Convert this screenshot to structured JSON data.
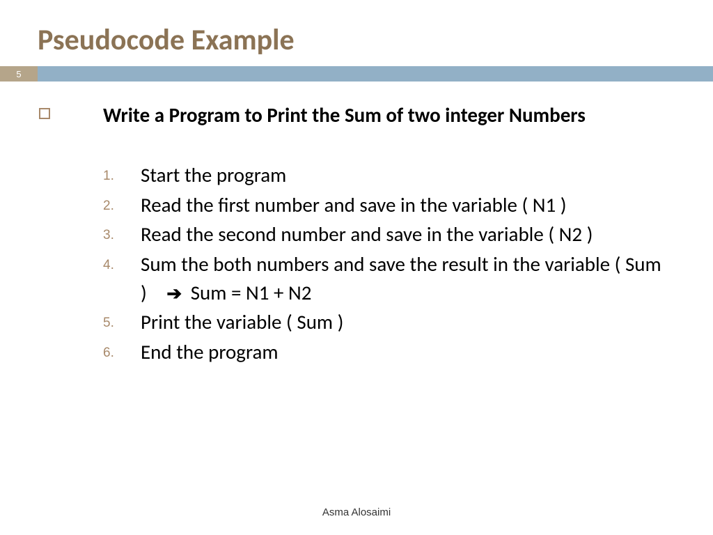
{
  "title": "Pseudocode Example",
  "page_number": "5",
  "headline": "Write a Program to Print the Sum of two integer Numbers",
  "steps": [
    {
      "num": "1.",
      "text": "Start the program"
    },
    {
      "num": "2.",
      "text": "Read the first number and save in  the variable ( N1 )"
    },
    {
      "num": "3.",
      "text": "Read the second number and save in the variable ( N2 )"
    },
    {
      "num": "4.",
      "text": "Sum the both numbers and save the result in the variable ( Sum )",
      "arrow_suffix": "Sum = N1 + N2"
    },
    {
      "num": "5.",
      "text": "Print the variable ( Sum )"
    },
    {
      "num": "6.",
      "text": "End the program"
    }
  ],
  "author": "Asma Alosaimi"
}
